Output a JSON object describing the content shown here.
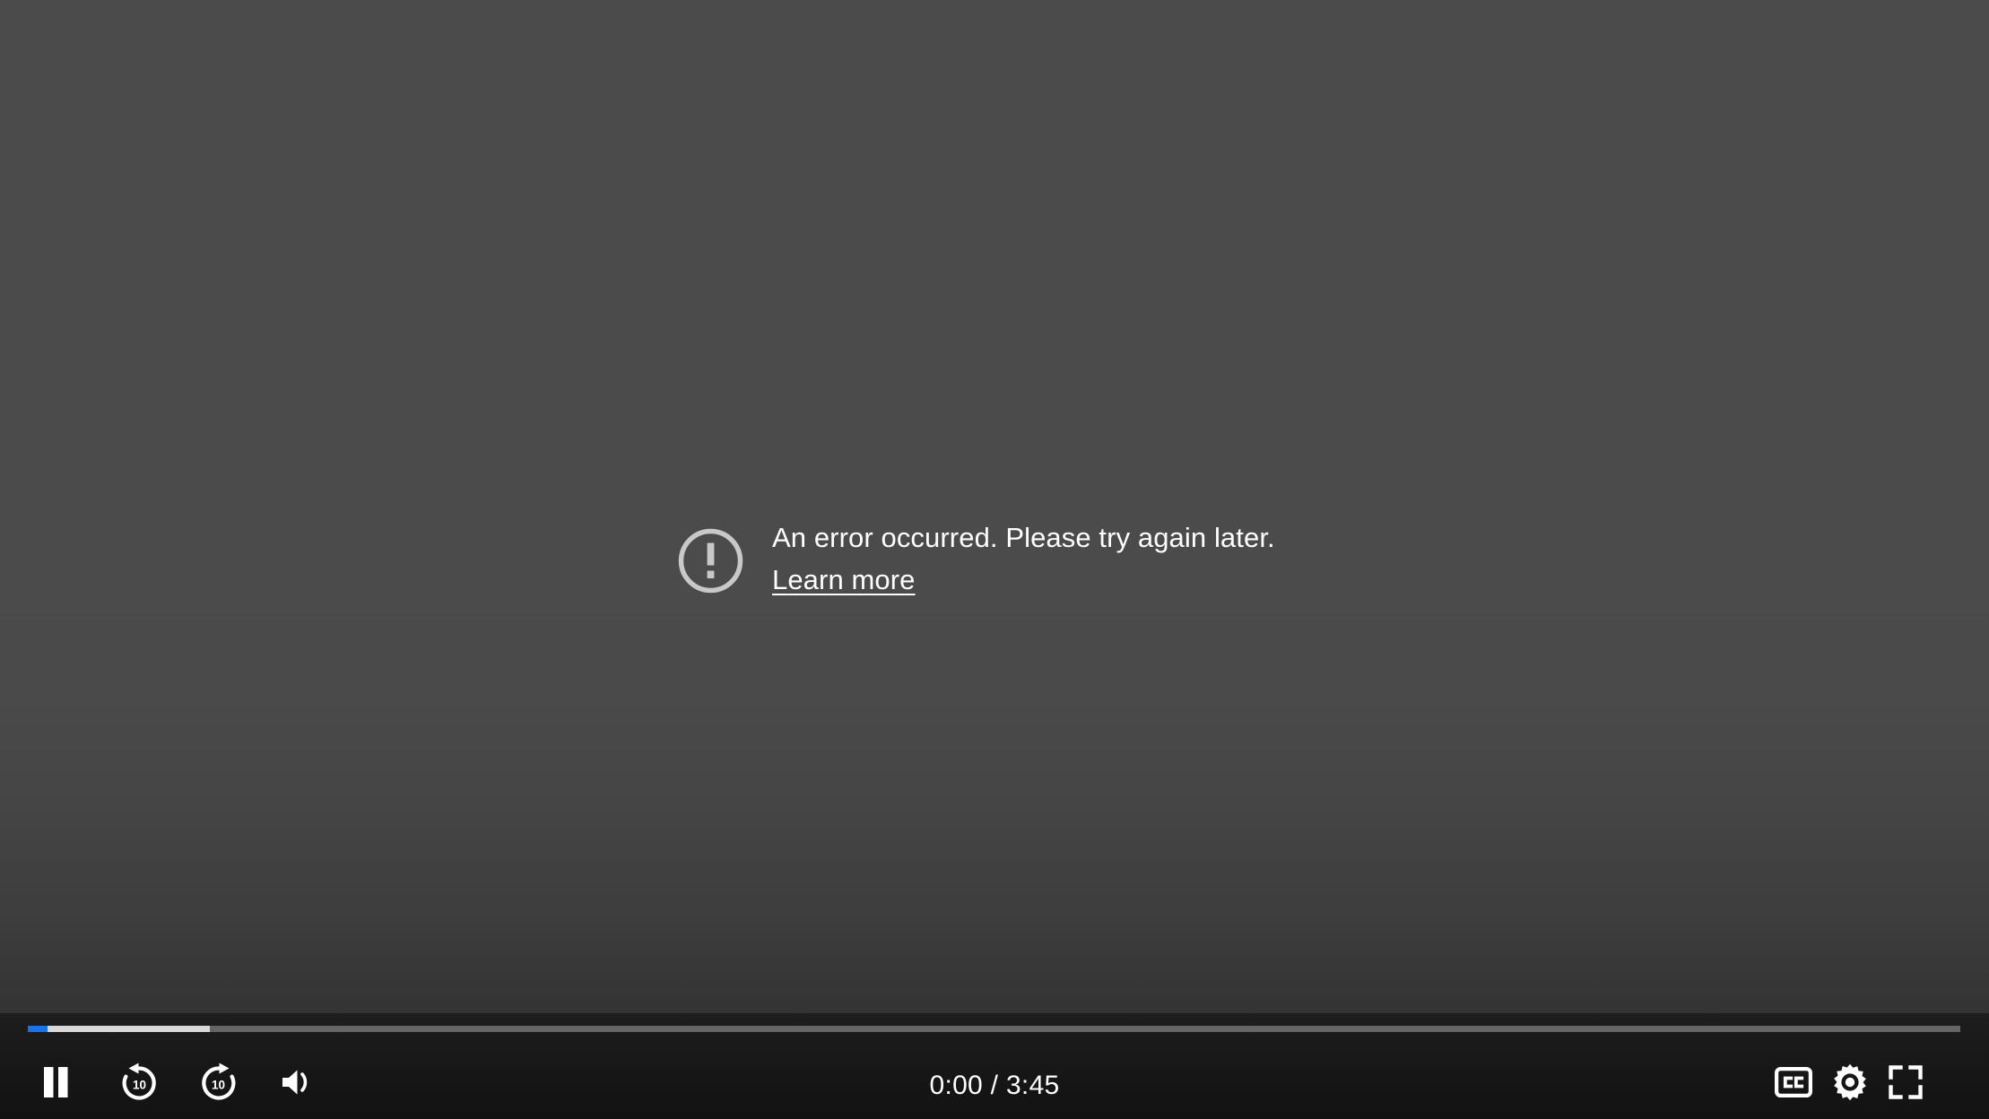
{
  "player": {
    "state": "error",
    "background_top_color": "#4b4b4b",
    "background_bottom_color": "#262626"
  },
  "error": {
    "icon": "circle-exclamation-icon",
    "icon_color": "#c8c8c8",
    "message": "An error occurred. Please try again later.",
    "link_label": "Learn more"
  },
  "progress": {
    "played_percent": 1.0,
    "loaded_percent": 9.4,
    "buffer_percent": 100,
    "played_color": "#1a73e8",
    "loaded_color": "#d8d8d8",
    "buffer_color": "#656565",
    "track_color": "#3f3f3f"
  },
  "controls": {
    "play_pause": {
      "label": "Pause",
      "icon": "pause-icon"
    },
    "rewind": {
      "label": "Rewind 10 seconds",
      "icon": "replay-10-icon",
      "seconds": "10"
    },
    "forward": {
      "label": "Forward 10 seconds",
      "icon": "forward-10-icon",
      "seconds": "10"
    },
    "volume": {
      "label": "Mute",
      "icon": "volume-medium-icon"
    },
    "captions": {
      "label": "Subtitles/closed captions",
      "icon": "closed-captions-icon"
    },
    "settings": {
      "label": "Settings",
      "icon": "gear-icon"
    },
    "fullscreen": {
      "label": "Full screen",
      "icon": "fullscreen-icon"
    }
  },
  "time": {
    "current": "0:00",
    "separator": " / ",
    "duration": "3:45",
    "display": "0:00 / 3:45"
  }
}
